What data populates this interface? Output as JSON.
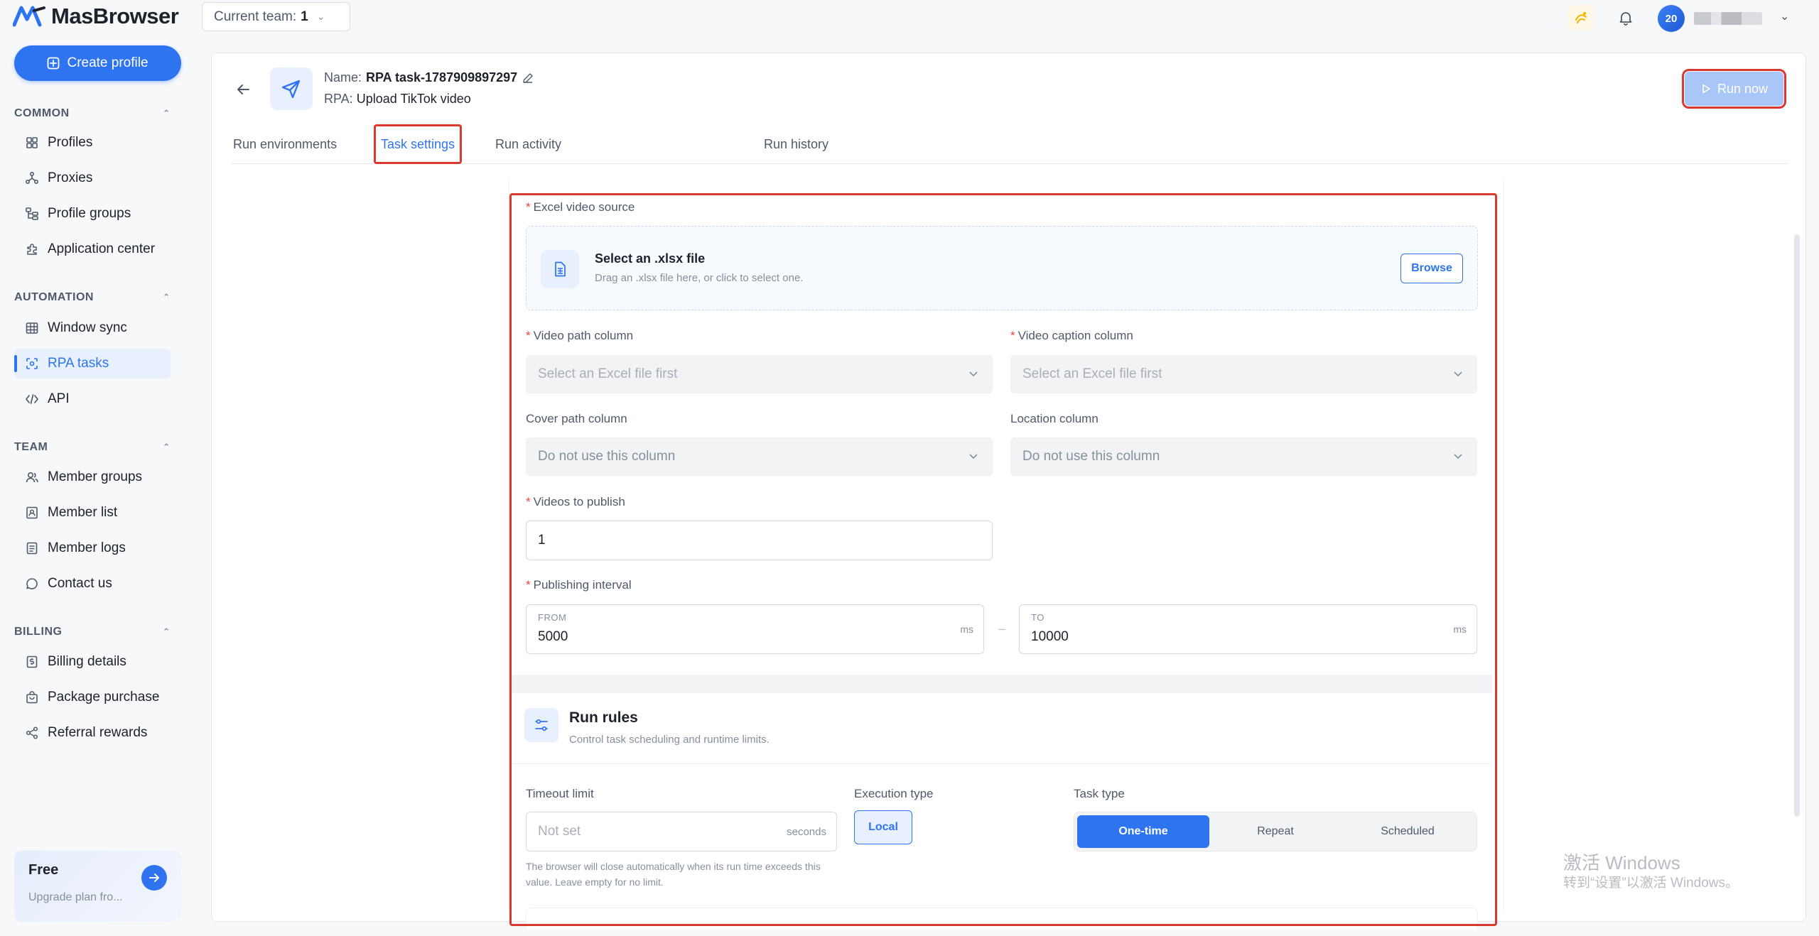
{
  "app": {
    "name": "MasBrowser",
    "accent": "#2e74f0",
    "highlight": "#d9392e"
  },
  "topbar": {
    "team_label": "Current team:",
    "team_value": "1",
    "icons": [
      "theme-icon",
      "bell-icon"
    ],
    "avatar_text": "20"
  },
  "sidebar": {
    "create_label": "Create profile",
    "sections": {
      "common": "COMMON",
      "automation": "AUTOMATION",
      "team": "TEAM",
      "billing": "BILLING"
    },
    "items": {
      "profiles": "Profiles",
      "proxies": "Proxies",
      "profile_groups": "Profile groups",
      "application_center": "Application center",
      "window_sync": "Window sync",
      "rpa_tasks": "RPA tasks",
      "api": "API",
      "member_groups": "Member groups",
      "member_list": "Member list",
      "member_logs": "Member logs",
      "contact_us": "Contact us",
      "billing_details": "Billing details",
      "package_purchase": "Package purchase",
      "referral_rewards": "Referral rewards"
    },
    "plan": {
      "name": "Free",
      "desc": "Upgrade plan fro..."
    }
  },
  "task": {
    "name_label": "Name:",
    "name_value": "RPA task-1787909897297",
    "rpa_label": "RPA:",
    "rpa_value": "Upload TikTok video",
    "run_now": "Run now"
  },
  "tabs": {
    "run_environments": "Run environments",
    "task_settings": "Task settings",
    "run_activity": "Run activity",
    "run_history": "Run history"
  },
  "form": {
    "excel_source_label": "Excel video source",
    "drop_title": "Select an .xlsx file",
    "drop_desc": "Drag an .xlsx file here, or click to select one.",
    "browse": "Browse",
    "video_path_label": "Video path column",
    "video_path_placeholder": "Select an Excel file first",
    "video_caption_label": "Video caption column",
    "video_caption_placeholder": "Select an Excel file first",
    "cover_path_label": "Cover path column",
    "cover_path_value": "Do not use this column",
    "location_label": "Location column",
    "location_value": "Do not use this column",
    "videos_to_publish_label": "Videos to publish",
    "videos_to_publish_value": "1",
    "interval_label": "Publishing interval",
    "from_label": "FROM",
    "from_value": "5000",
    "from_unit": "ms",
    "dash": "–",
    "to_label": "TO",
    "to_value": "10000",
    "to_unit": "ms"
  },
  "run_rules": {
    "title": "Run rules",
    "desc": "Control task scheduling and runtime limits.",
    "timeout_label": "Timeout limit",
    "timeout_placeholder": "Not set",
    "timeout_unit": "seconds",
    "timeout_hint": "The browser will close automatically when its run time exceeds this value. Leave empty for no limit.",
    "execution_label": "Execution type",
    "execution_value": "Local",
    "task_type_label": "Task type",
    "task_types": [
      "One-time",
      "Repeat",
      "Scheduled"
    ],
    "task_type_selected": "One-time"
  },
  "watermark": {
    "line1": "激活 Windows",
    "line2": "转到“设置”以激活 Windows。"
  }
}
